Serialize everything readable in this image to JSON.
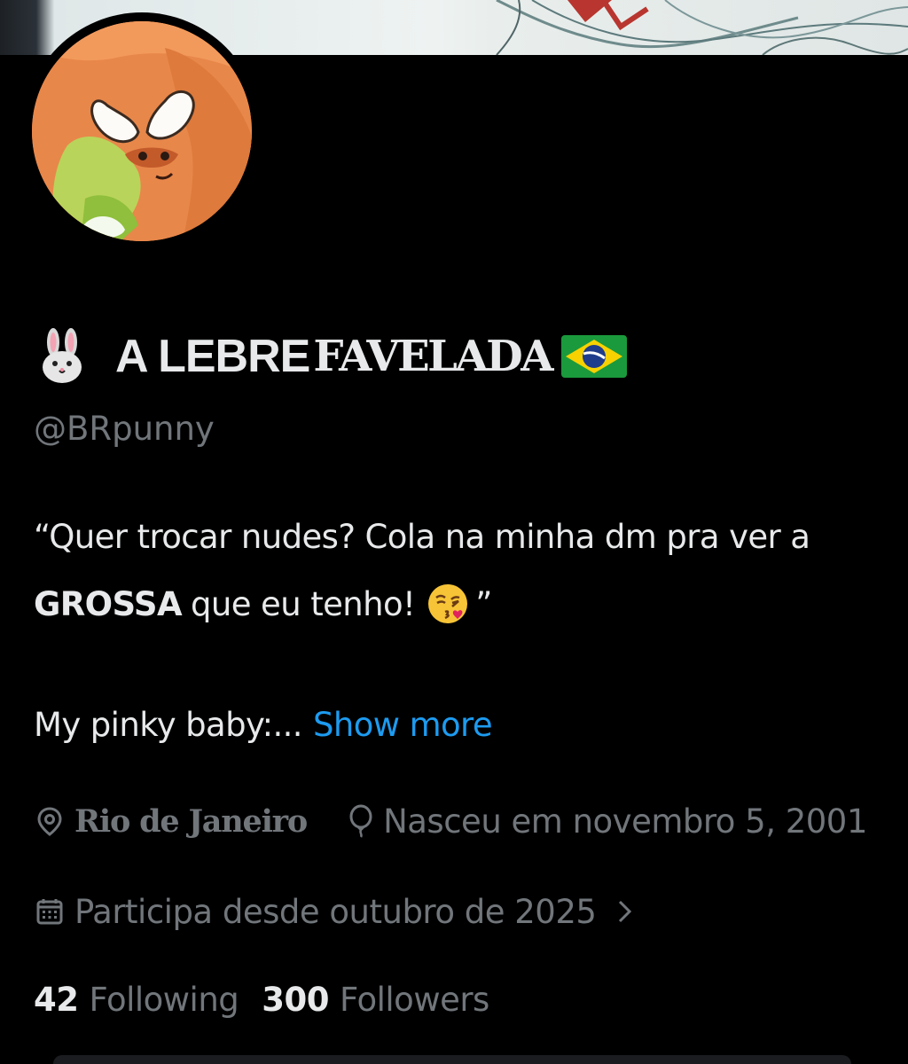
{
  "profile": {
    "name_part1": "A LEBRE",
    "name_part2": "FAVELADA",
    "name_emoji_icon": "rabbit-face-icon",
    "name_flag_icon": "brazil-flag-icon",
    "handle": "@BRpunny"
  },
  "bio": {
    "line1": "“Quer trocar nudes? Cola na minha dm pra ver a",
    "line2_bold": "GROSSA",
    "line2_rest": "que eu tenho!",
    "line2_emoji_icon": "face-blowing-kiss-icon",
    "line2_close_quote": "”",
    "line3": "My pinky baby:...",
    "show_more": "Show more"
  },
  "meta": {
    "location": "Rio de Janeiro",
    "birth": "Nasceu em novembro 5, 2001",
    "joined": "Participa desde outubro de 2025"
  },
  "stats": {
    "following_count": "42",
    "following_label": "Following",
    "followers_count": "300",
    "followers_label": "Followers"
  },
  "colors": {
    "background": "#000000",
    "text_primary": "#e7e9ea",
    "text_secondary": "#71767b",
    "link": "#1d9bf0"
  }
}
